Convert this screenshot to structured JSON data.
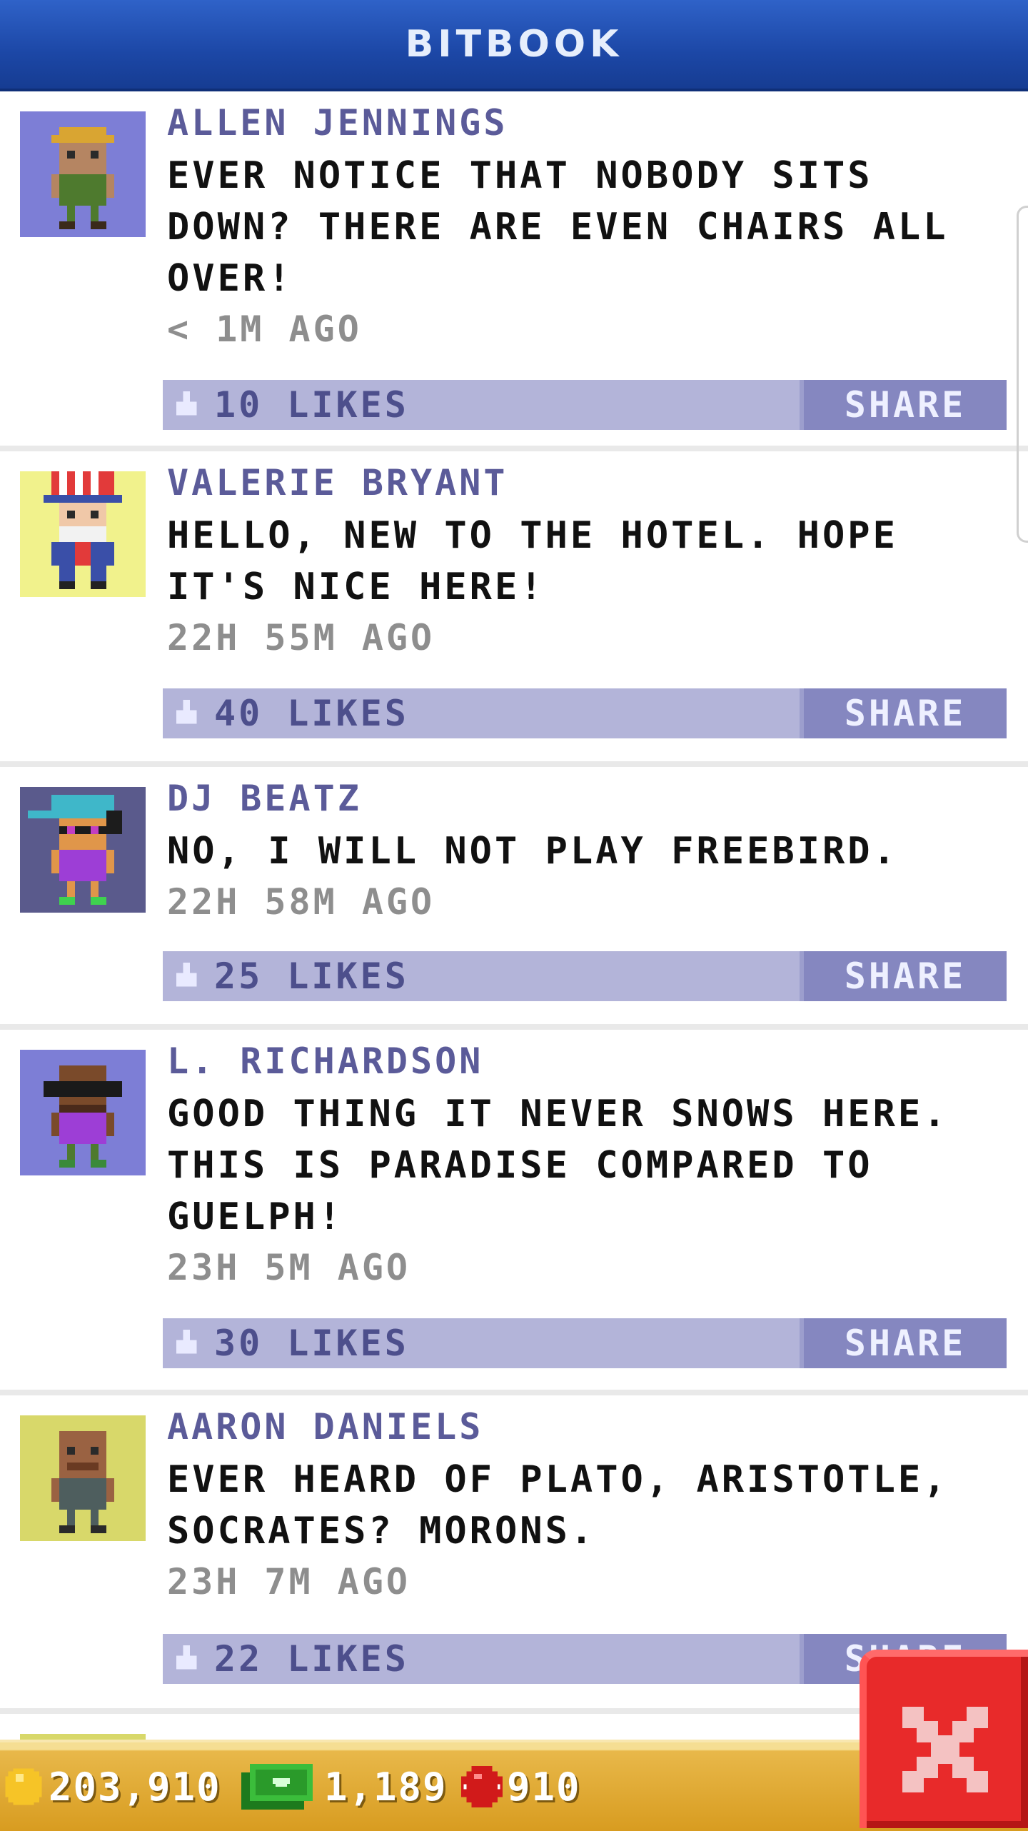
{
  "header": {
    "title": "BITBOOK"
  },
  "posts": [
    {
      "author": "ALLEN JENNINGS",
      "message": "EVER NOTICE THAT NOBODY SITS DOWN? THERE ARE EVEN CHAIRS ALL OVER!",
      "time": "< 1M AGO",
      "likes": "10 LIKES",
      "share": "SHARE",
      "avatar": "allen-jennings-avatar"
    },
    {
      "author": "VALERIE BRYANT",
      "message": "HELLO, NEW TO THE HOTEL. HOPE IT'S NICE HERE!",
      "time": "22H 55M AGO",
      "likes": "40 LIKES",
      "share": "SHARE",
      "avatar": "valerie-bryant-avatar"
    },
    {
      "author": "DJ BEATZ",
      "message": "NO, I WILL NOT PLAY FREEBIRD.",
      "time": "22H 58M AGO",
      "likes": "25 LIKES",
      "share": "SHARE",
      "avatar": "dj-beatz-avatar"
    },
    {
      "author": "L. RICHARDSON",
      "message": "GOOD THING IT NEVER SNOWS HERE. THIS IS PARADISE COMPARED TO GUELPH!",
      "time": "23H 5M AGO",
      "likes": "30 LIKES",
      "share": "SHARE",
      "avatar": "l-richardson-avatar"
    },
    {
      "author": "AARON DANIELS",
      "message": "EVER HEARD OF PLATO, ARISTOTLE, SOCRATES? MORONS.",
      "time": "23H 7M AGO",
      "likes": "22 LIKES",
      "share": "SHARE",
      "avatar": "aaron-daniels-avatar"
    }
  ],
  "currency": {
    "coins": "203,910",
    "bux": "1,189",
    "gems": "910"
  },
  "colors": {
    "header": "#1c47a6",
    "author": "#5b5b99",
    "likes_bar": "#b3b4d9",
    "share_button": "#8587c0",
    "close_button": "#e82a2a",
    "bottom_bar": "#e8b84a"
  }
}
